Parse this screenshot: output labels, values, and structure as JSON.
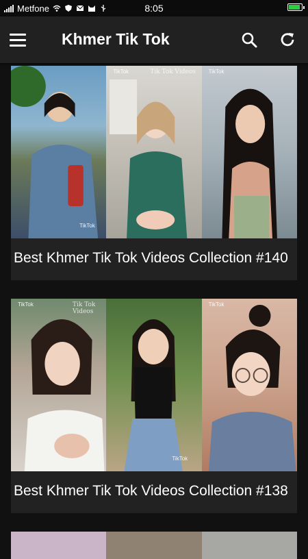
{
  "status_bar": {
    "carrier": "Metfone",
    "time": "8:05"
  },
  "app_bar": {
    "title": "Khmer Tik Tok",
    "icons": [
      "menu-icon",
      "search-icon",
      "refresh-icon"
    ]
  },
  "videos": [
    {
      "title": "Best Khmer Tik Tok Videos Collection #140",
      "thumb_texts": {
        "tiktok": "TikTok",
        "tiktok_videos": "Tik Tok Videos"
      }
    },
    {
      "title": "Best Khmer Tik Tok Videos Collection #138",
      "thumb_texts": {
        "tiktok": "TikTok",
        "tiktok_videos": "Tik Tok Videos"
      }
    }
  ],
  "colors": {
    "background": "#111111",
    "app_bar": "#212121",
    "card": "#222222",
    "text": "#ffffff",
    "battery": "#2ecc40"
  }
}
